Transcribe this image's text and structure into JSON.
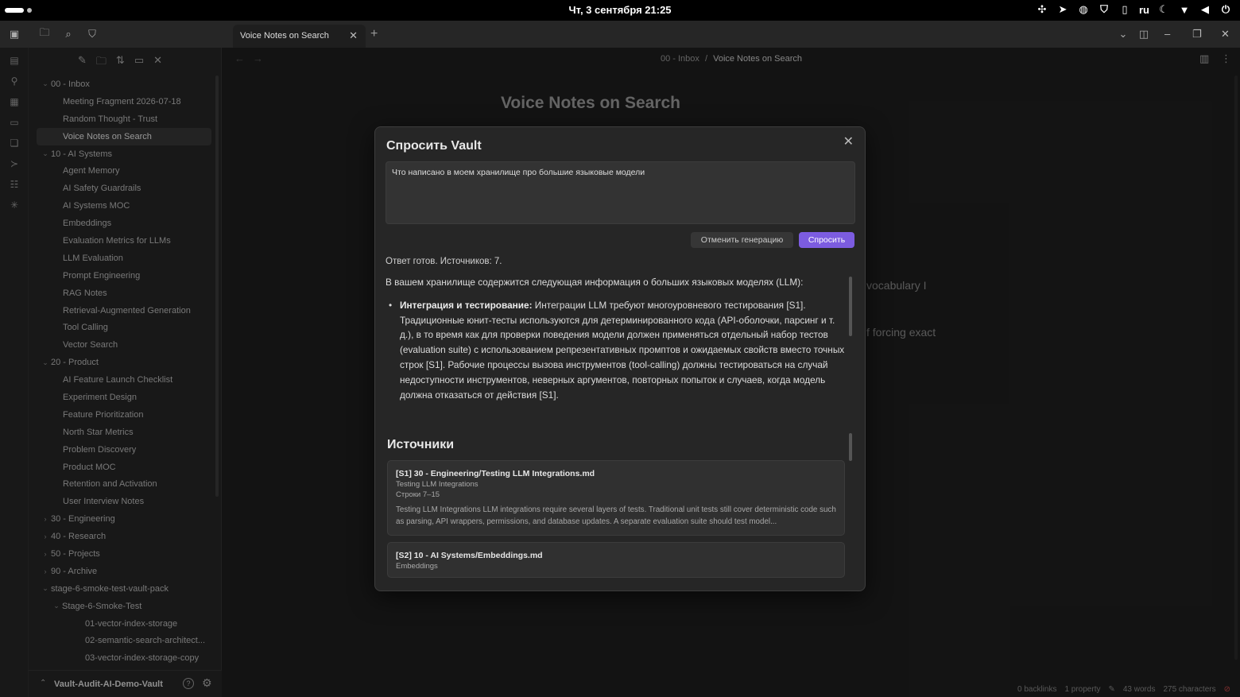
{
  "system_bar": {
    "clock": "Чт, 3 сентября  21:25",
    "lang": "ru"
  },
  "tab": {
    "title": "Voice Notes on Search"
  },
  "breadcrumb": {
    "folder": "00 - Inbox",
    "separator": "/",
    "current": "Voice Notes on Search"
  },
  "note": {
    "title": "Voice Notes on Search",
    "visible_fragment_1": "vocabulary I",
    "visible_fragment_2": "f forcing exact"
  },
  "tree": [
    {
      "label": "00 - Inbox",
      "type": "folder",
      "expanded": true
    },
    {
      "label": "Meeting Fragment 2026-07-18",
      "type": "file"
    },
    {
      "label": "Random Thought - Trust",
      "type": "file"
    },
    {
      "label": "Voice Notes on Search",
      "type": "file",
      "active": true
    },
    {
      "label": "10 - AI Systems",
      "type": "folder",
      "expanded": true
    },
    {
      "label": "Agent Memory",
      "type": "file"
    },
    {
      "label": "AI Safety Guardrails",
      "type": "file"
    },
    {
      "label": "AI Systems MOC",
      "type": "file"
    },
    {
      "label": "Embeddings",
      "type": "file"
    },
    {
      "label": "Evaluation Metrics for LLMs",
      "type": "file"
    },
    {
      "label": "LLM Evaluation",
      "type": "file"
    },
    {
      "label": "Prompt Engineering",
      "type": "file"
    },
    {
      "label": "RAG Notes",
      "type": "file"
    },
    {
      "label": "Retrieval-Augmented Generation",
      "type": "file"
    },
    {
      "label": "Tool Calling",
      "type": "file"
    },
    {
      "label": "Vector Search",
      "type": "file"
    },
    {
      "label": "20 - Product",
      "type": "folder",
      "expanded": true
    },
    {
      "label": "AI Feature Launch Checklist",
      "type": "file"
    },
    {
      "label": "Experiment Design",
      "type": "file"
    },
    {
      "label": "Feature Prioritization",
      "type": "file"
    },
    {
      "label": "North Star Metrics",
      "type": "file"
    },
    {
      "label": "Problem Discovery",
      "type": "file"
    },
    {
      "label": "Product MOC",
      "type": "file"
    },
    {
      "label": "Retention and Activation",
      "type": "file"
    },
    {
      "label": "User Interview Notes",
      "type": "file"
    },
    {
      "label": "30 - Engineering",
      "type": "folder",
      "expanded": false
    },
    {
      "label": "40 - Research",
      "type": "folder",
      "expanded": false
    },
    {
      "label": "50 - Projects",
      "type": "folder",
      "expanded": false
    },
    {
      "label": "90 - Archive",
      "type": "folder",
      "expanded": false
    },
    {
      "label": "stage-6-smoke-test-vault-pack",
      "type": "folder",
      "expanded": true
    },
    {
      "label": "Stage-6-Smoke-Test",
      "type": "folder",
      "expanded": true,
      "depth": 1
    },
    {
      "label": "01-vector-index-storage",
      "type": "file",
      "depth": 2
    },
    {
      "label": "02-semantic-search-architect...",
      "type": "file",
      "depth": 2
    },
    {
      "label": "03-vector-index-storage-copy",
      "type": "file",
      "depth": 2
    }
  ],
  "vault": {
    "name": "Vault-Audit-AI-Demo-Vault"
  },
  "statusbar": {
    "backlinks": "0 backlinks",
    "properties": "1 property",
    "words": "43 words",
    "characters": "275 characters"
  },
  "modal": {
    "title": "Спросить Vault",
    "question": "Что написано в моем хранилище про большие языковые модели",
    "cancel_label": "Отменить генерацию",
    "ask_label": "Спросить",
    "status": "Ответ готов. Источников: 7.",
    "answer_intro": "В вашем хранилище содержится следующая информация о больших языковых моделях (LLM):",
    "bullet_bold": "Интеграция и тестирование:",
    "bullet_text": " Интеграции LLM требуют многоуровневого тестирования [S1]. Традиционные юнит-тесты используются для детерминированного кода (API-оболочки, парсинг и т. д.), в то время как для проверки поведения модели должен применяться отдельный набор тестов (evaluation suite) с использованием репрезентативных промптов и ожидаемых свойств вместо точных строк [S1]. Рабочие процессы вызова инструментов (tool-calling) должны тестироваться на случай недоступности инструментов, неверных аргументов, повторных попыток и случаев, когда модель должна отказаться от действия [S1].",
    "sources_title": "Источники",
    "sources": [
      {
        "heading": "[S1] 30 - Engineering/Testing LLM Integrations.md",
        "title": "Testing LLM Integrations",
        "lines": "Строки 7–15",
        "snippet": "Testing LLM Integrations LLM integrations require several layers of tests. Traditional unit tests still cover deterministic code such as parsing, API wrappers, permissions, and database updates. A separate evaluation suite should test model..."
      },
      {
        "heading": "[S2] 10 - AI Systems/Embeddings.md",
        "title": "Embeddings",
        "lines": "",
        "snippet": ""
      }
    ]
  },
  "colors": {
    "accent": "#7c5ce0",
    "background": "#1e1e1e",
    "panel": "#262626"
  }
}
